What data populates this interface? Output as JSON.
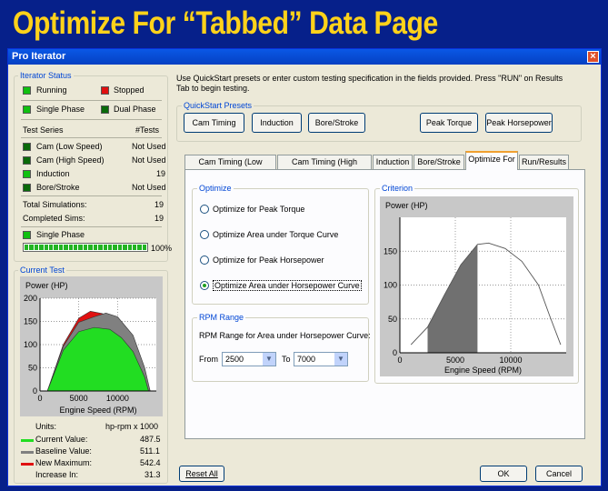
{
  "slide_title": "Optimize For “Tabbed” Data Page",
  "window": {
    "title": "Pro Iterator",
    "close_glyph": "×"
  },
  "iterator_status": {
    "label": "Iterator Status",
    "running": "Running",
    "stopped": "Stopped",
    "single_phase": "Single Phase",
    "dual_phase": "Dual Phase",
    "test_series_header": "Test Series",
    "tests_header": "#Tests",
    "series": [
      {
        "name": "Cam (Low Speed)",
        "tests": "Not Used"
      },
      {
        "name": "Cam (High Speed)",
        "tests": "Not Used"
      },
      {
        "name": "Induction",
        "tests": "19"
      },
      {
        "name": "Bore/Stroke",
        "tests": "Not Used"
      }
    ],
    "total_label": "Total Simulations:",
    "total_value": "19",
    "completed_label": "Completed Sims:",
    "completed_value": "19",
    "phase_label": "Single Phase",
    "progress_percent": 100,
    "progress_text": "100%"
  },
  "current_test": {
    "label": "Current Test",
    "chart_title": "Power (HP)",
    "xlabel": "Engine Speed (RPM)",
    "units_label": "Units:",
    "units_value": "hp-rpm x 1000",
    "legend": [
      {
        "label": "Current Value:",
        "value": "487.5",
        "color": "#22dd22"
      },
      {
        "label": "Baseline Value:",
        "value": "511.1",
        "color": "#808080"
      },
      {
        "label": "New Maximum:",
        "value": "542.4",
        "color": "#e01010"
      },
      {
        "label": "Increase In:",
        "value": "31.3",
        "color": ""
      }
    ]
  },
  "intro_text": "Use QuickStart presets or enter custom testing specification in the fields provided. Press \"RUN\" on Results Tab to begin testing.",
  "quickstart": {
    "label": "QuickStart Presets",
    "buttons": [
      "Cam Timing",
      "Induction",
      "Bore/Stroke",
      "Peak Torque",
      "Peak Horsepower"
    ]
  },
  "tabs": [
    "Cam Timing (Low Speed)",
    "Cam Timing (High Speed)",
    "Induction",
    "Bore/Stroke",
    "Optimize For",
    "Run/Results"
  ],
  "active_tab": "Optimize For",
  "optimize": {
    "label": "Optimize",
    "options": [
      "Optimize for Peak Torque",
      "Optimize Area under Torque Curve",
      "Optimize for Peak Horsepower",
      "Optimize Area under Horsepower Curve"
    ],
    "selected_index": 3
  },
  "rpm_range": {
    "label": "RPM Range",
    "caption": "RPM Range for Area under Horsepower Curve:",
    "from_label": "From",
    "from_value": "2500",
    "to_label": "To",
    "to_value": "7000",
    "dropdown_glyph": "▼"
  },
  "criterion": {
    "label": "Criterion",
    "chart_title": "Power (HP)",
    "xlabel": "Engine Speed (RPM)"
  },
  "footer": {
    "reset": "Reset All",
    "ok": "OK",
    "cancel": "Cancel"
  },
  "chart_data": [
    {
      "type": "area",
      "title": "Power (HP)",
      "xlabel": "Engine Speed (RPM)",
      "ylabel": "",
      "xlim": [
        0,
        15000
      ],
      "ylim": [
        0,
        200
      ],
      "xticks": [
        0,
        5000,
        10000
      ],
      "xtick_labels": [
        "0",
        "5000",
        "10000"
      ],
      "yticks": [
        0,
        50,
        100,
        150,
        200
      ],
      "ytick_labels": [
        "0",
        "50",
        "100",
        "150",
        "200"
      ],
      "grid": true,
      "series": [
        {
          "name": "",
          "color": "#e01010",
          "x": [
            1000,
            3000,
            5000,
            6500,
            8000,
            10000,
            12000,
            13500,
            14200
          ],
          "y": [
            2,
            100,
            157,
            172,
            167,
            155,
            110,
            40,
            0
          ]
        },
        {
          "name": "",
          "color": "#808080",
          "x": [
            1000,
            3000,
            5000,
            7000,
            8500,
            10000,
            12000,
            13500,
            14200
          ],
          "y": [
            2,
            96,
            148,
            160,
            168,
            160,
            120,
            50,
            0
          ]
        },
        {
          "name": "",
          "color": "#22dd22",
          "x": [
            1000,
            3000,
            5000,
            7000,
            9000,
            10500,
            12000,
            13500,
            14000
          ],
          "y": [
            2,
            88,
            128,
            137,
            133,
            115,
            85,
            30,
            0
          ]
        }
      ]
    },
    {
      "type": "area",
      "title": "Power (HP)",
      "xlabel": "Engine Speed (RPM)",
      "ylabel": "",
      "xlim": [
        0,
        15000
      ],
      "ylim": [
        0,
        200
      ],
      "xticks": [
        0,
        5000,
        10000
      ],
      "xtick_labels": [
        "0",
        "5000",
        "10000"
      ],
      "yticks": [
        0,
        50,
        100,
        150
      ],
      "ytick_labels": [
        "0",
        "50",
        "100",
        "150"
      ],
      "grid": true,
      "shaded_range": [
        2500,
        7000
      ],
      "series": [
        {
          "name": "",
          "color": "#555555",
          "x": [
            1000,
            2500,
            4000,
            5500,
            7000,
            8000,
            9500,
            11000,
            12500,
            13500,
            14500
          ],
          "y": [
            12,
            38,
            85,
            130,
            160,
            162,
            154,
            135,
            100,
            55,
            12
          ]
        }
      ]
    }
  ]
}
